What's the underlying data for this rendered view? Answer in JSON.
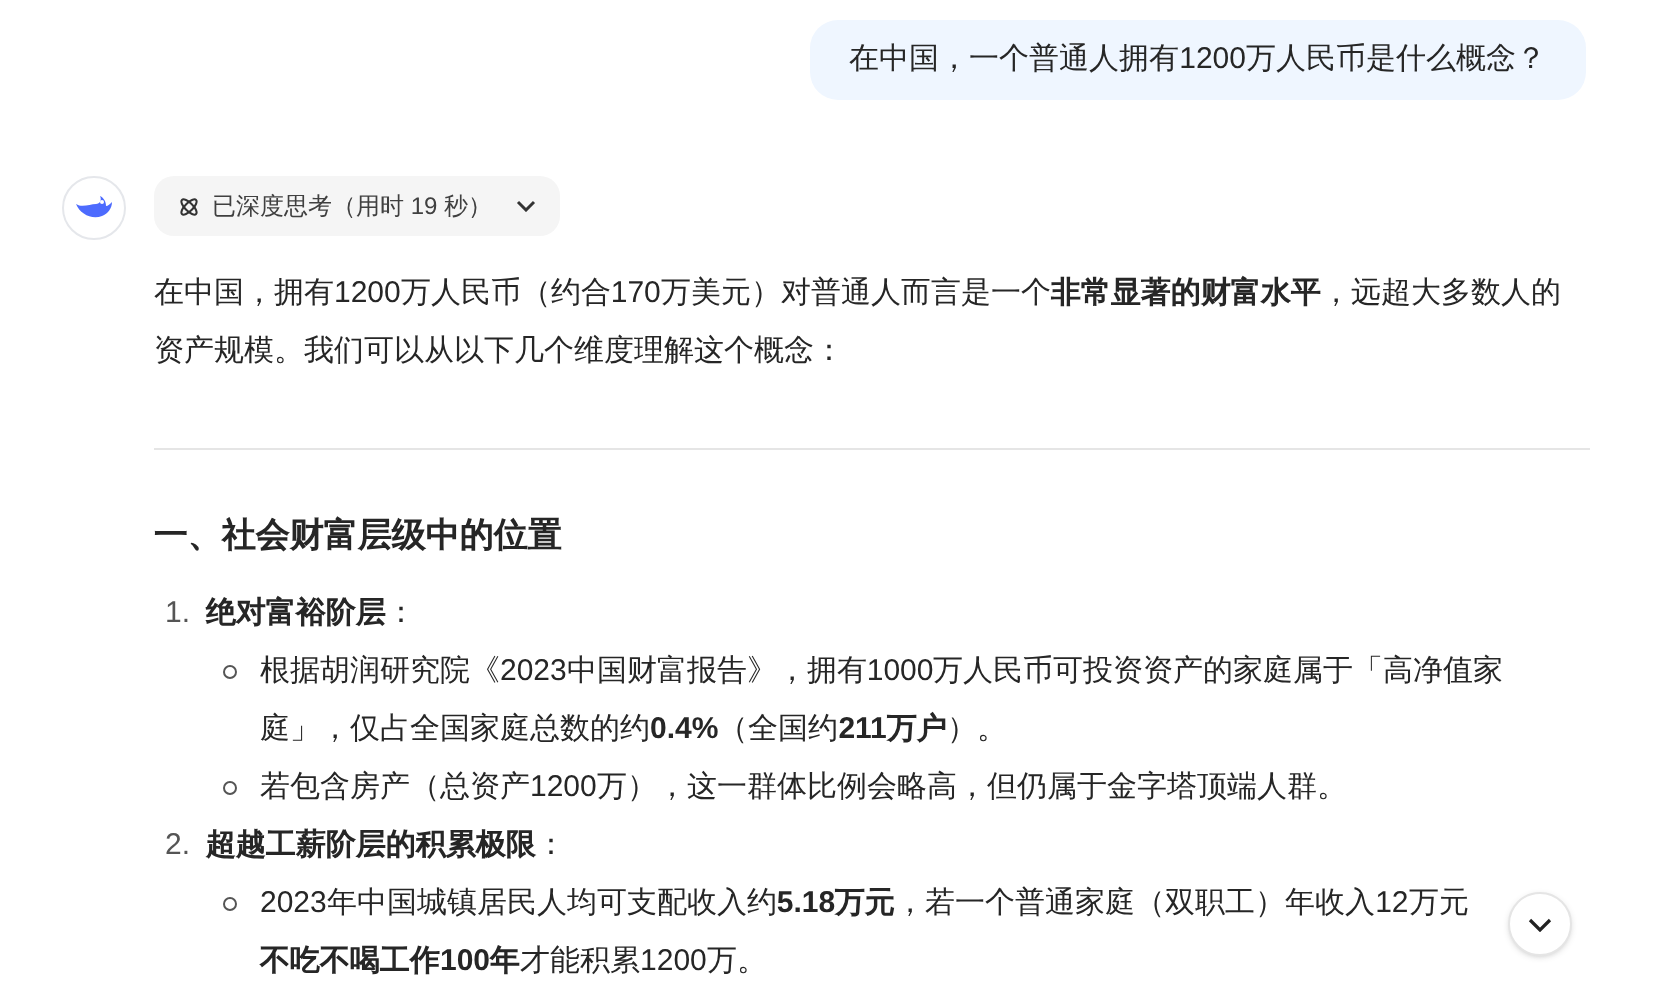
{
  "user_message": "在中国，一个普通人拥有1200万人民币是什么概念？",
  "thinking": {
    "label": "已深度思考（用时 19 秒）"
  },
  "answer": {
    "intro": "在中国，拥有1200万人民币（约合170万美元）对普通人而言是一个**非常显著的财富水平**，远超大多数人的资产规模。我们可以从以下几个维度理解这个概念：",
    "sections": [
      {
        "heading": "一、社会财富层级中的位置",
        "items": [
          {
            "number": "1.",
            "title": "**绝对富裕阶层**：",
            "bullets": [
              "根据胡润研究院《2023中国财富报告》，拥有1000万人民币可投资资产的家庭属于「高净值家庭」，仅占全国家庭总数的约**0.4%**（全国约**211万户**）。",
              "若包含房产（总资产1200万），这一群体比例会略高，但仍属于金字塔顶端人群。"
            ]
          },
          {
            "number": "2.",
            "title": "**超越工薪阶层的积累极限**：",
            "bullets": [
              "2023年中国城镇居民人均可支配收入约**5.18万元**，若一个普通家庭（双职工）年收入12万元**不吃不喝工作100年**才能积累1200万。"
            ]
          }
        ]
      }
    ]
  }
}
